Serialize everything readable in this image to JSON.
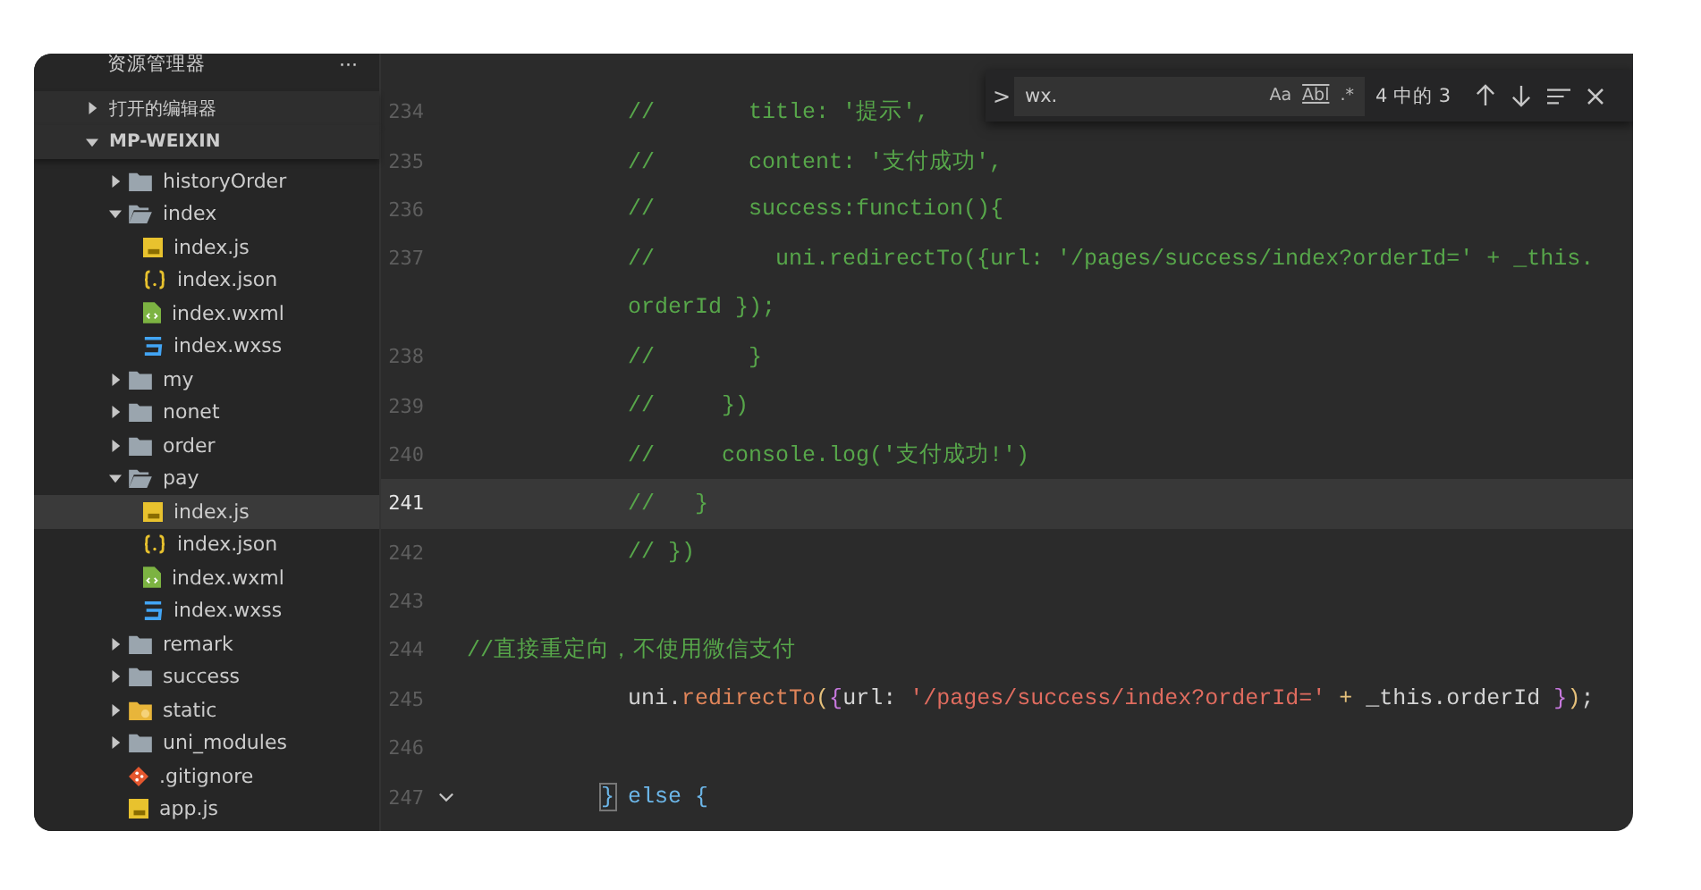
{
  "explorer": {
    "title": "资源管理器",
    "more": "···",
    "sections": [
      {
        "label": "打开的编辑器",
        "expanded": false
      },
      {
        "label": "MP-WEIXIN",
        "expanded": true
      }
    ],
    "tree": [
      {
        "children": [
          {
            "label": "historyOrder",
            "kind": "folder",
            "expanded": false,
            "selected": false
          },
          {
            "label": "index",
            "kind": "folder",
            "expanded": true,
            "selected": false,
            "children": [
              {
                "label": "index.js",
                "kind": "js",
                "selected": false
              },
              {
                "label": "index.json",
                "kind": "json",
                "selected": false
              },
              {
                "label": "index.wxml",
                "kind": "wxml",
                "selected": false
              },
              {
                "label": "index.wxss",
                "kind": "wxss",
                "selected": false
              }
            ]
          },
          {
            "label": "my",
            "kind": "folder",
            "expanded": false,
            "selected": false
          },
          {
            "label": "nonet",
            "kind": "folder",
            "expanded": false,
            "selected": false
          },
          {
            "label": "order",
            "kind": "folder",
            "expanded": false,
            "selected": false
          },
          {
            "label": "pay",
            "kind": "folder",
            "expanded": true,
            "selected": false,
            "children": [
              {
                "label": "index.js",
                "kind": "js",
                "selected": true
              },
              {
                "label": "index.json",
                "kind": "json",
                "selected": false
              },
              {
                "label": "index.wxml",
                "kind": "wxml",
                "selected": false
              },
              {
                "label": "index.wxss",
                "kind": "wxss",
                "selected": false
              }
            ]
          },
          {
            "label": "remark",
            "kind": "folder",
            "expanded": false,
            "selected": false
          },
          {
            "label": "success",
            "kind": "folder",
            "expanded": false,
            "selected": false
          }
        ]
      },
      {
        "label": "static",
        "kind": "assets-folder",
        "expanded": false,
        "selected": false
      },
      {
        "label": "uni_modules",
        "kind": "folder",
        "expanded": false,
        "selected": false
      },
      {
        "label": ".gitignore",
        "kind": "git",
        "selected": false
      },
      {
        "label": "app.js",
        "kind": "js",
        "selected": false
      }
    ]
  },
  "find": {
    "value": "wx.",
    "toggle": ">",
    "case": "Aa",
    "word": "Abl",
    "regex": ".*",
    "count": "4 中的 3"
  },
  "editor": {
    "lines": [
      {
        "number": "234",
        "current": false,
        "kind": "block",
        "segments": [
          {
            "kind": "comment",
            "text": "//       title: '提示',"
          }
        ]
      },
      {
        "number": "235",
        "current": false,
        "kind": "block",
        "segments": [
          {
            "kind": "comment",
            "text": "//       content: '支付成功',"
          }
        ]
      },
      {
        "number": "236",
        "current": false,
        "kind": "block",
        "segments": [
          {
            "kind": "comment",
            "text": "//       success:function(){"
          }
        ]
      },
      {
        "number": "237",
        "current": false,
        "kind": "block",
        "segments": [
          {
            "kind": "comment",
            "text": "//         uni.redirectTo({url: '/pages/success/index?orderId=' + _this."
          }
        ]
      },
      {
        "kind": "block",
        "segments": [
          {
            "kind": "comment",
            "text": "orderId });"
          }
        ]
      },
      {
        "number": "238",
        "current": false,
        "kind": "block",
        "segments": [
          {
            "kind": "comment",
            "text": "//       }"
          }
        ]
      },
      {
        "number": "239",
        "current": false,
        "kind": "block",
        "segments": [
          {
            "kind": "comment",
            "text": "//     })"
          }
        ]
      },
      {
        "number": "240",
        "current": false,
        "kind": "block",
        "segments": [
          {
            "kind": "comment",
            "text": "//     console.log('支付成功!')"
          }
        ]
      },
      {
        "number": "241",
        "current": true,
        "kind": "block",
        "segments": [
          {
            "kind": "comment",
            "text": "//   }"
          }
        ]
      },
      {
        "number": "242",
        "current": false,
        "kind": "block",
        "segments": [
          {
            "kind": "comment",
            "text": "// })"
          }
        ]
      },
      {
        "number": "243",
        "current": false
      },
      {
        "number": "244",
        "current": false,
        "segments": [
          {
            "kind": "comment",
            "text": "//直接重定向，不使用微信支付"
          }
        ]
      },
      {
        "number": "245",
        "current": false,
        "kind": "block",
        "segments": [
          {
            "kind": "plain",
            "text": "uni."
          },
          {
            "kind": "method",
            "text": "redirectTo"
          },
          {
            "kind": "paren",
            "text": "("
          },
          {
            "kind": "brace",
            "text": "{"
          },
          {
            "kind": "plain",
            "text": "url: "
          },
          {
            "kind": "string",
            "text": "'/pages/success/index?orderId='"
          },
          {
            "kind": "operator",
            "text": " + "
          },
          {
            "kind": "plain",
            "text": "_this.orderId "
          },
          {
            "kind": "brace",
            "text": "}"
          },
          {
            "kind": "paren",
            "text": ")"
          },
          {
            "kind": "plain",
            "text": ";"
          }
        ]
      },
      {
        "number": "246",
        "current": false
      },
      {
        "number": "247",
        "current": false,
        "foldable": true,
        "kind": "close",
        "segments": [
          {
            "kind": "bracket-match",
            "text": "}"
          },
          {
            "kind": "keyword",
            "text": " else {"
          }
        ]
      }
    ]
  }
}
